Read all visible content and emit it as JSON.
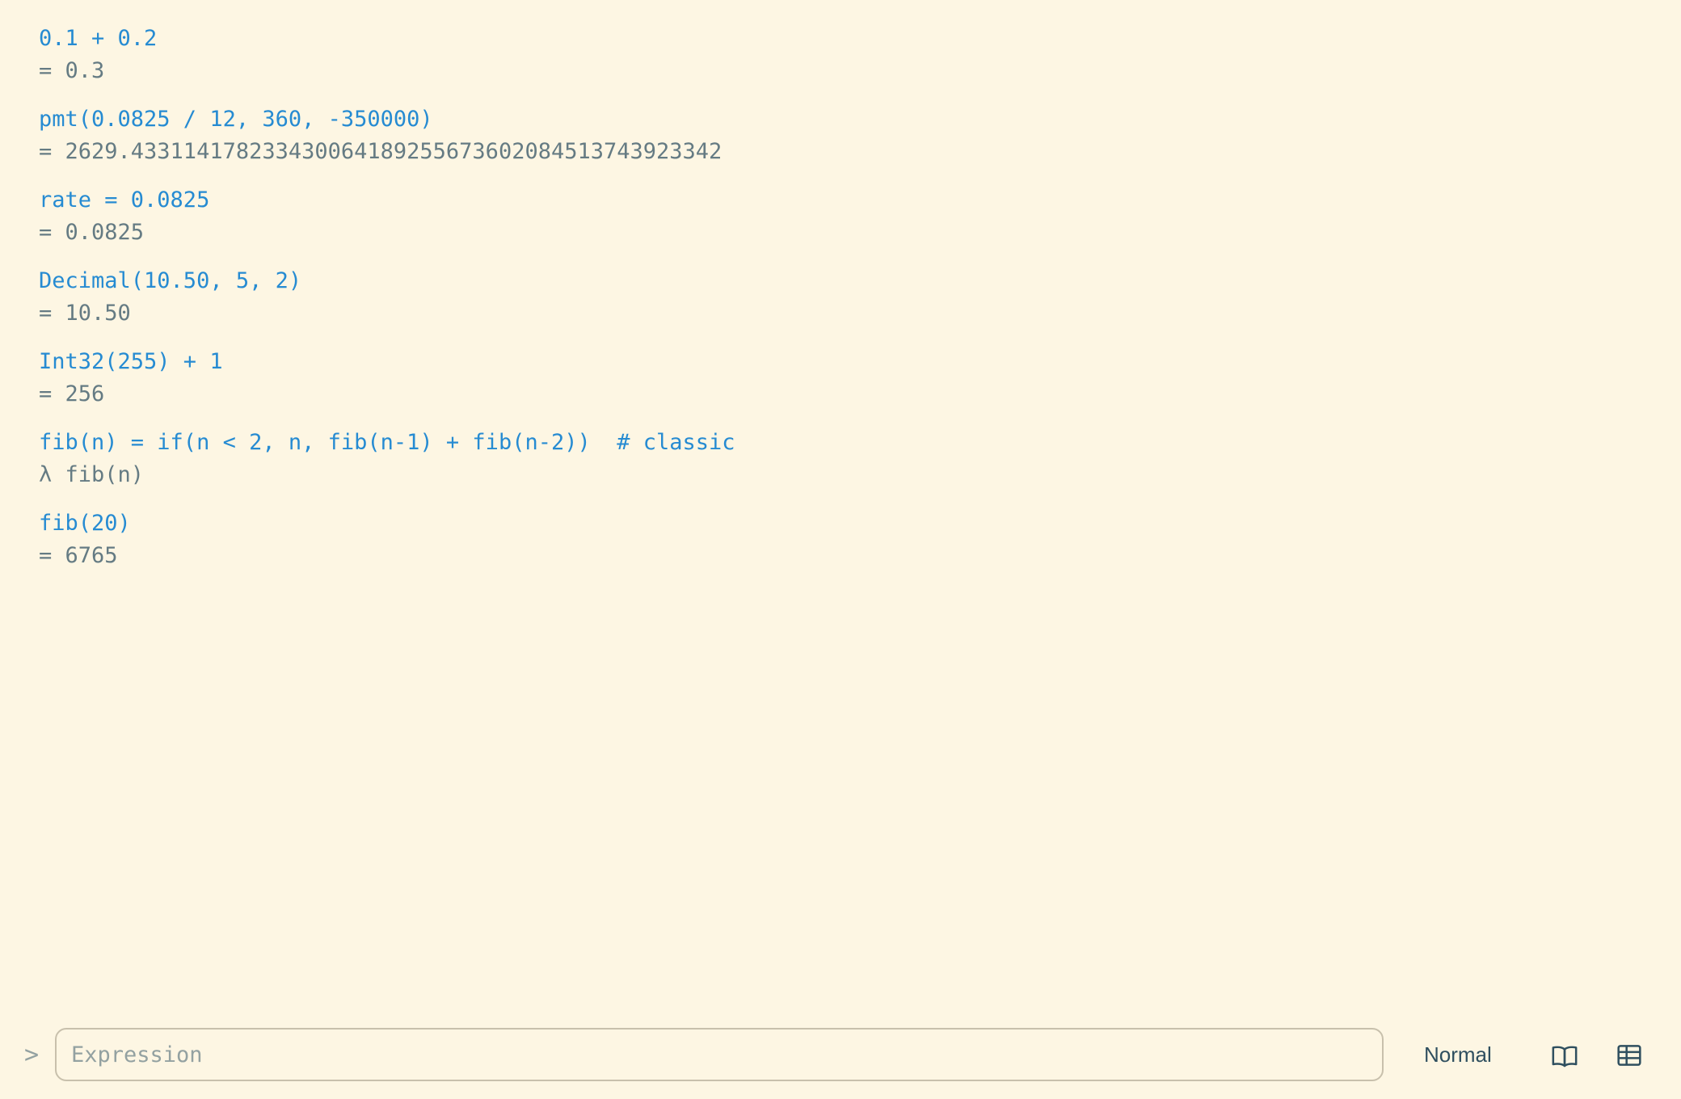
{
  "history": [
    {
      "input": "0.1 + 0.2",
      "output": "= 0.3"
    },
    {
      "input": "pmt(0.0825 / 12, 360, -350000)",
      "output": "= 2629.43311417823343006418925567360208451374392334​2"
    },
    {
      "input": "rate = 0.0825",
      "output": "= 0.0825"
    },
    {
      "input": "Decimal(10.50, 5, 2)",
      "output": "= 10.50"
    },
    {
      "input": "Int32(255) + 1",
      "output": "= 256"
    },
    {
      "input": "fib(n) = if(n < 2, n, fib(n-1) + fib(n-2))  # classic",
      "output": "λ fib(n)"
    },
    {
      "input": "fib(20)",
      "output": "= 6765"
    }
  ],
  "input_bar": {
    "prompt": ">",
    "placeholder": "Expression",
    "value": ""
  },
  "mode": {
    "label": "Normal"
  },
  "icons": {
    "docs": "book-open-icon",
    "table": "table-icon"
  },
  "colors": {
    "background": "#fdf6e3",
    "input_text": "#268bd2",
    "output_text": "#657b83"
  }
}
